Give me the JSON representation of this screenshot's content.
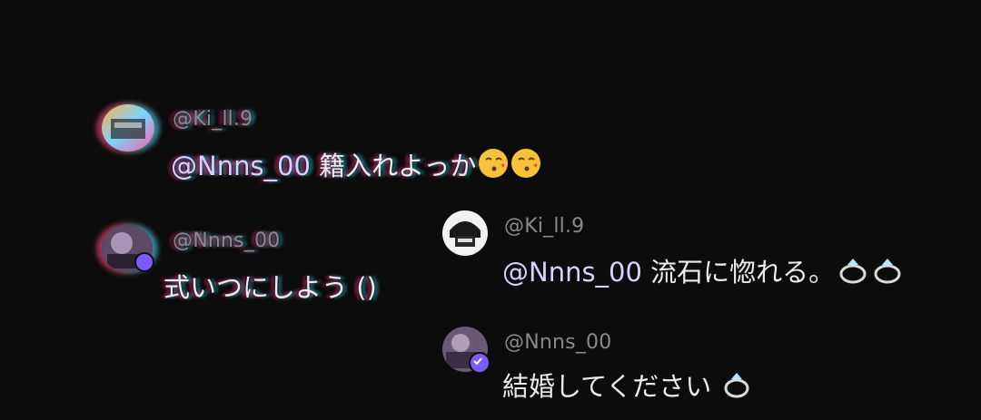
{
  "comments": [
    {
      "username": "@Ki_ll.9",
      "mention": "@Nnns_00",
      "text": " 籍入れよっか",
      "emoji": [
        "kissing-face-emoji",
        "kissing-face-emoji"
      ],
      "avatar": "avatar-ki-ll-9",
      "verified": false
    },
    {
      "username": "@Nnns_00",
      "text": "式いつにしよう ()",
      "avatar": "avatar-nnns-00",
      "verified": true
    },
    {
      "username": "@Ki_ll.9",
      "mention": "@Nnns_00",
      "text": " 流石に惚れる。",
      "emoji": [
        "ring-emoji",
        "ring-emoji"
      ],
      "avatar": "avatar-ki-ll-9",
      "verified": false
    },
    {
      "username": "@Nnns_00",
      "text": "結婚してください",
      "emoji": [
        "ring-emoji"
      ],
      "avatar": "avatar-nnns-00",
      "verified": true
    }
  ],
  "colors": {
    "background": "#0c0c0c",
    "username": "#8a8a8a",
    "message": "#ececec",
    "mention": "#d6d0ff",
    "verified_badge": "#7c5cff"
  }
}
